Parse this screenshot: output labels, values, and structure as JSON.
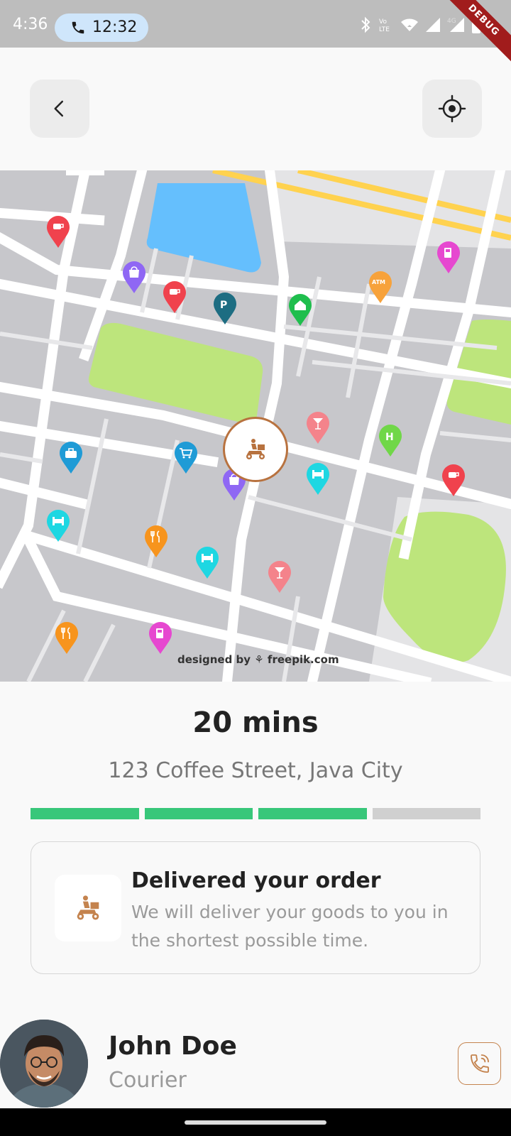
{
  "status_bar": {
    "time": "4:36",
    "call_duration": "12:32",
    "icons": [
      "phone-icon",
      "bluetooth-icon",
      "volte-icon",
      "wifi-icon",
      "signal-icon",
      "signal-4g-icon",
      "battery-icon"
    ],
    "network_label": "4G",
    "debug_label": "DEBUG"
  },
  "header": {
    "back_icon": "chevron-left-icon",
    "locate_icon": "crosshair-icon"
  },
  "map": {
    "credit": "designed by ⚘ freepik.com",
    "courier_icon": "delivery-scooter-icon",
    "accent_color": "#b8723f"
  },
  "eta": {
    "duration": "20 mins",
    "address": "123 Coffee Street, Java City",
    "progress": {
      "completed_steps": 3,
      "total_steps": 4
    }
  },
  "info_card": {
    "title": "Delivered your order",
    "description": "We will deliver your goods to you in the shortest possible time."
  },
  "courier": {
    "name": "John Doe",
    "role": "Courier",
    "call_icon": "phone-call-icon"
  },
  "colors": {
    "progress_done": "#38c77a",
    "progress_todo": "#d0d0d0",
    "accent": "#c4834e"
  }
}
